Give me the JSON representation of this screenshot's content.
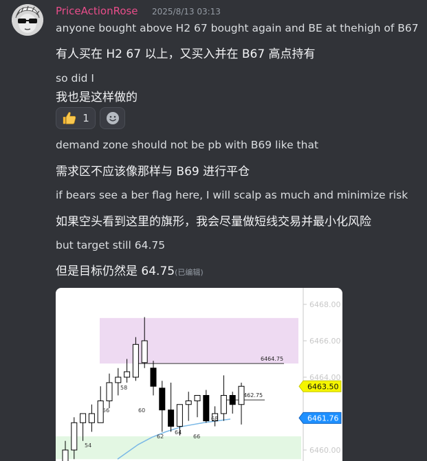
{
  "message": {
    "author": "PriceActionRose",
    "timestamp": "2025/8/13 03:13",
    "lines": [
      {
        "en": "anyone bought above  H2 67 bought again and BE at thehigh of B67",
        "zh": "有人买在 H2 67 以上，又买入并在 B67 高点持有"
      },
      {
        "en": "so did I",
        "zh": "我也是这样做的"
      },
      {
        "en": "demand zone should not be pb with B69 like that",
        "zh": "需求区不应该像那样与 B69 进行平仓"
      },
      {
        "en": "if bears see a ber flag here, I will scalp as much and minimize risk",
        "zh": "如果空头看到这里的旗形，我会尽量做短线交易并最小化风险"
      },
      {
        "en": "but target still 64.75",
        "zh": "但是目标仍然是 64.75"
      }
    ],
    "edited_label": "(已编辑)",
    "reaction": {
      "emoji": "thumbs-up",
      "count": "1"
    }
  },
  "chart_data": {
    "type": "candlestick",
    "y_ticks": [
      "6468.00",
      "6466.00",
      "6464.00",
      "6460.00"
    ],
    "ylim": [
      6459.5,
      6468.5
    ],
    "price_tags": [
      {
        "label": "6463.50",
        "value": 6463.5,
        "color": "#f5f500"
      },
      {
        "label": "6461.76",
        "value": 6461.76,
        "color": "#1e90ff"
      }
    ],
    "level_labels": [
      {
        "label": "6464.75",
        "value": 6464.75
      },
      {
        "label": "6462.75",
        "value": 6462.75
      }
    ],
    "bar_labels": [
      "54",
      "56",
      "58",
      "60",
      "62",
      "64",
      "66",
      "68"
    ],
    "zones": [
      {
        "name": "supply",
        "from": 6464.75,
        "to": 6467.25,
        "color": "#eedaf2"
      },
      {
        "name": "demand",
        "from": 6459.5,
        "to": 6460.75,
        "color": "#e3f7e3"
      }
    ],
    "candles": [
      {
        "o": 6459.0,
        "h": 6460.5,
        "l": 6459.0,
        "c": 6460.0
      },
      {
        "o": 6460.0,
        "h": 6461.8,
        "l": 6459.5,
        "c": 6461.5
      },
      {
        "o": 6461.5,
        "h": 6462.0,
        "l": 6460.5,
        "c": 6462.0
      },
      {
        "o": 6461.5,
        "h": 6462.5,
        "l": 6461.0,
        "c": 6462.0
      },
      {
        "o": 6461.5,
        "h": 6463.5,
        "l": 6461.5,
        "c": 6462.7
      },
      {
        "o": 6462.7,
        "h": 6464.2,
        "l": 6462.3,
        "c": 6463.7
      },
      {
        "o": 6463.7,
        "h": 6464.5,
        "l": 6463.0,
        "c": 6464.0
      },
      {
        "o": 6464.0,
        "h": 6465.0,
        "l": 6463.7,
        "c": 6464.3
      },
      {
        "o": 6464.0,
        "h": 6466.2,
        "l": 6463.8,
        "c": 6465.8
      },
      {
        "o": 6464.8,
        "h": 6467.3,
        "l": 6464.5,
        "c": 6466.0
      },
      {
        "o": 6464.5,
        "h": 6464.9,
        "l": 6463.0,
        "c": 6463.5
      },
      {
        "o": 6463.4,
        "h": 6463.8,
        "l": 6461.0,
        "c": 6462.2
      },
      {
        "o": 6462.2,
        "h": 6463.7,
        "l": 6461.0,
        "c": 6461.3
      },
      {
        "o": 6461.3,
        "h": 6462.3,
        "l": 6460.8,
        "c": 6462.5
      },
      {
        "o": 6462.5,
        "h": 6463.2,
        "l": 6461.6,
        "c": 6462.7
      },
      {
        "o": 6462.7,
        "h": 6463.0,
        "l": 6461.8,
        "c": 6463.0
      },
      {
        "o": 6463.0,
        "h": 6463.3,
        "l": 6461.5,
        "c": 6461.6
      },
      {
        "o": 6461.6,
        "h": 6462.4,
        "l": 6461.3,
        "c": 6462.0
      },
      {
        "o": 6462.0,
        "h": 6464.1,
        "l": 6461.6,
        "c": 6463.0
      },
      {
        "o": 6463.0,
        "h": 6463.2,
        "l": 6462.0,
        "c": 6462.5
      },
      {
        "o": 6462.5,
        "h": 6463.7,
        "l": 6461.4,
        "c": 6463.5
      }
    ],
    "ema": [
      6459.5,
      6459.9,
      6460.3,
      6460.7,
      6461.0,
      6461.3,
      6461.5,
      6461.7
    ]
  }
}
